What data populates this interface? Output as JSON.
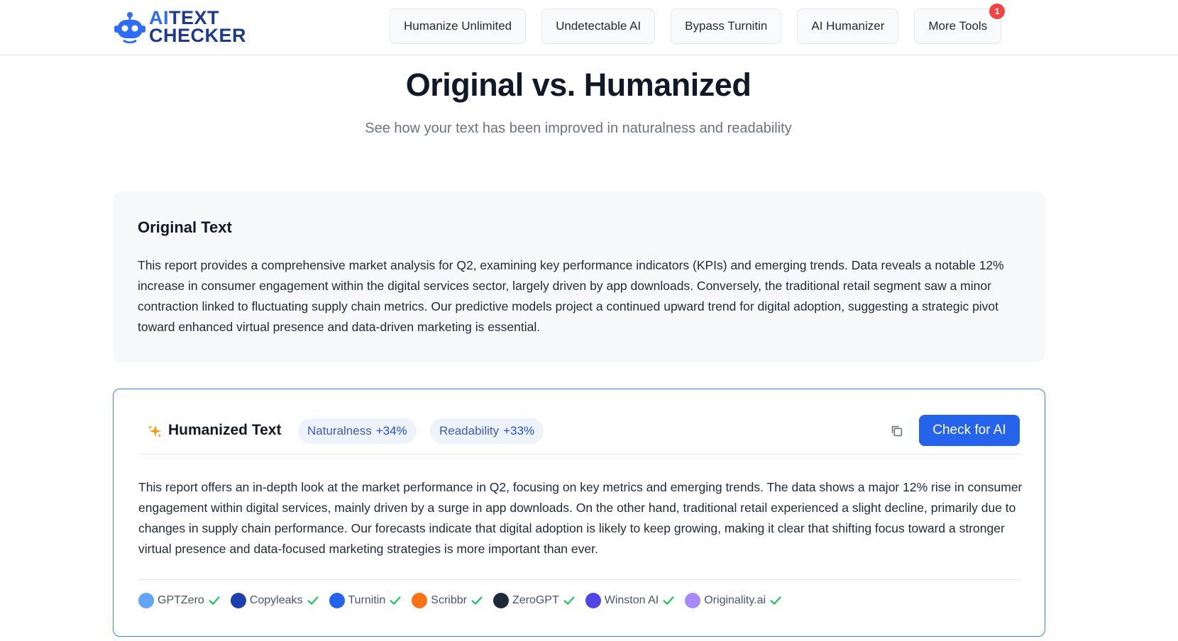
{
  "header": {
    "logo_line1_accent": "AI",
    "logo_line1_rest": "TEXT",
    "logo_line2": "CHECKER",
    "nav": [
      {
        "label": "Humanize Unlimited"
      },
      {
        "label": "Undetectable AI"
      },
      {
        "label": "Bypass Turnitin"
      },
      {
        "label": "AI Humanizer"
      },
      {
        "label": "More Tools",
        "badge": "1"
      }
    ]
  },
  "hero": {
    "title": "Original vs. Humanized",
    "subtitle": "See how your text has been improved in naturalness and readability"
  },
  "original": {
    "title": "Original Text",
    "text": "This report provides a comprehensive market analysis for Q2, examining key performance indicators (KPIs) and emerging trends. Data reveals a notable 12% increase in consumer engagement within the digital services sector, largely driven by app downloads. Conversely, the traditional retail segment saw a minor contraction linked to fluctuating supply chain metrics. Our predictive models project a continued upward trend for digital adoption, suggesting a strategic pivot toward enhanced virtual presence and data-driven marketing is essential."
  },
  "humanized": {
    "icon": "sparkle-icon",
    "title": "Humanized Text",
    "metrics": [
      {
        "label": "Naturalness",
        "value": "+34%"
      },
      {
        "label": "Readability",
        "value": "+33%"
      }
    ],
    "copy_icon": "copy-icon",
    "check_button": "Check for AI",
    "text": "This report offers an in-depth look at the market performance in Q2, focusing on key metrics and emerging trends. The data shows a major 12% rise in consumer engagement within digital services, mainly driven by a surge in app downloads. On the other hand, traditional retail experienced a slight decline, primarily due to changes in supply chain performance. Our forecasts indicate that digital adoption is likely to keep growing, making it clear that shifting focus toward a stronger virtual presence and data-focused marketing strategies is more important than ever.",
    "detectors": [
      {
        "name": "GPTZero",
        "color": "#60a5fa",
        "status": "passed"
      },
      {
        "name": "Copyleaks",
        "color": "#1e40af",
        "status": "passed"
      },
      {
        "name": "Turnitin",
        "color": "#2563eb",
        "status": "passed"
      },
      {
        "name": "Scribbr",
        "color": "#f97316",
        "status": "passed"
      },
      {
        "name": "ZeroGPT",
        "color": "#1f2937",
        "status": "passed"
      },
      {
        "name": "Winston AI",
        "color": "#4f46e5",
        "status": "passed"
      },
      {
        "name": "Originality.ai",
        "color": "#a78bfa",
        "status": "passed"
      }
    ],
    "check_color": "#22c55e"
  },
  "colors": {
    "accent": "#2563eb",
    "pill_bg": "#eef2fb",
    "badge": "#ef4444"
  }
}
